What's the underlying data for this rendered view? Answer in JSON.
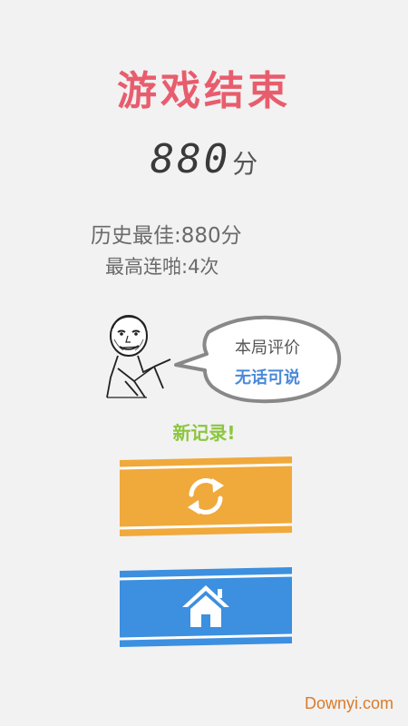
{
  "game_over": {
    "title": "游戏结束",
    "score_value": "880",
    "score_unit": "分"
  },
  "stats": {
    "best_score": "历史最佳:880分",
    "max_combo": "最高连啪:4次"
  },
  "evaluation": {
    "label": "本局评价",
    "verdict": "无话可说"
  },
  "new_record": "新记录!",
  "buttons": {
    "replay_icon": "refresh-icon",
    "home_icon": "home-icon"
  },
  "watermark": "Downyi.com",
  "colors": {
    "title": "#e85d6d",
    "replay_button": "#f0a93b",
    "home_button": "#3d8fe0",
    "new_record": "#8cc63f",
    "verdict": "#4a8ad8",
    "watermark": "#d97b2b"
  }
}
